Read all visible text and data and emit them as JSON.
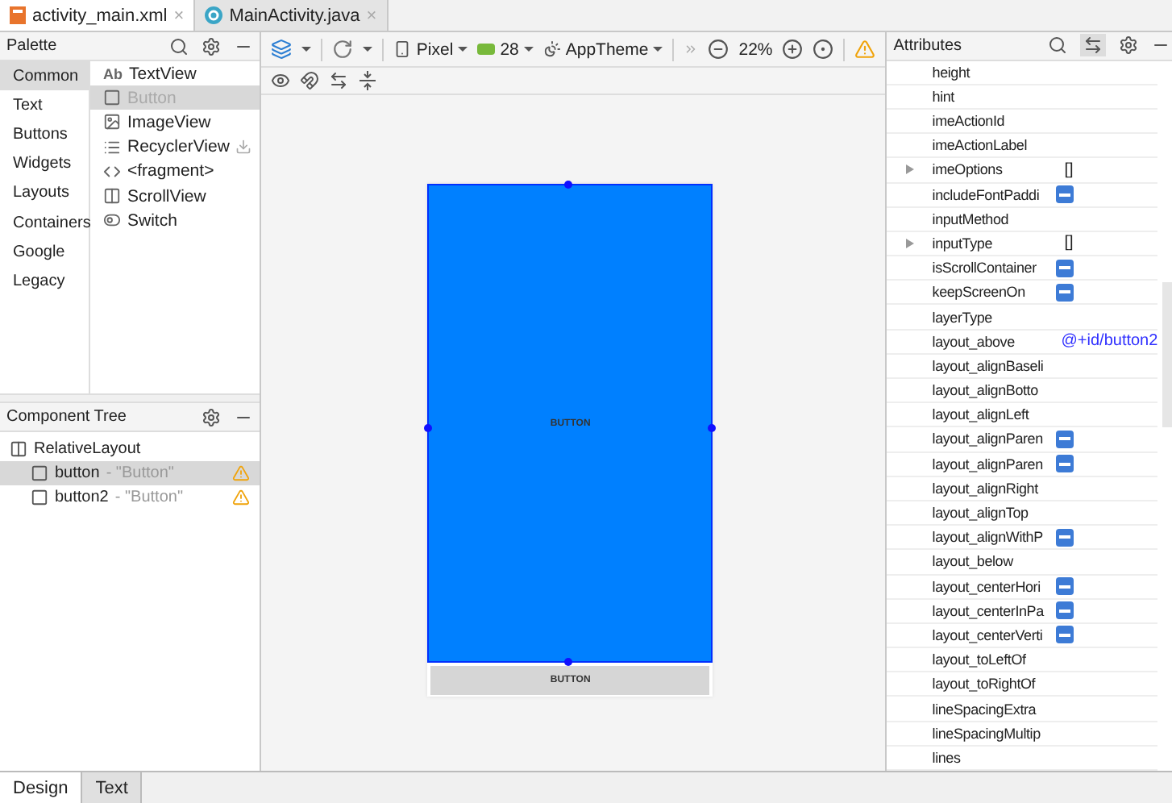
{
  "editor_tabs": [
    {
      "label": "activity_main.xml",
      "kind": "xml",
      "selected": true,
      "close": "×"
    },
    {
      "label": "MainActivity.java",
      "kind": "java",
      "selected": false,
      "close": "×"
    }
  ],
  "palette": {
    "title": "Palette",
    "categories": [
      {
        "label": "Common",
        "selected": true
      },
      {
        "label": "Text",
        "selected": false
      },
      {
        "label": "Buttons",
        "selected": false
      },
      {
        "label": "Widgets",
        "selected": false
      },
      {
        "label": "Layouts",
        "selected": false
      },
      {
        "label": "Containers",
        "selected": false
      },
      {
        "label": "Google",
        "selected": false
      },
      {
        "label": "Legacy",
        "selected": false
      }
    ],
    "items": [
      {
        "label": "TextView",
        "icon_text": "Ab",
        "kind": "text",
        "selected": false,
        "downloadable": false
      },
      {
        "label": "Button",
        "kind": "button",
        "selected": true,
        "downloadable": false
      },
      {
        "label": "ImageView",
        "kind": "image",
        "selected": false,
        "downloadable": false
      },
      {
        "label": "RecyclerView",
        "kind": "list",
        "selected": false,
        "downloadable": true
      },
      {
        "label": "<fragment>",
        "kind": "code",
        "selected": false,
        "downloadable": false
      },
      {
        "label": "ScrollView",
        "kind": "scroll",
        "selected": false,
        "downloadable": false
      },
      {
        "label": "Switch",
        "kind": "switch",
        "selected": false,
        "downloadable": false
      }
    ]
  },
  "component_tree": {
    "title": "Component Tree",
    "root": {
      "label": "RelativeLayout",
      "children": [
        {
          "id_label": "button",
          "text": "- \"Button\"",
          "selected": true,
          "warning": true
        },
        {
          "id_label": "button2",
          "text": "- \"Button\"",
          "selected": false,
          "warning": true
        }
      ]
    }
  },
  "toolbar": {
    "device": "Pixel",
    "api": "28",
    "theme": "AppTheme",
    "zoom": "22%"
  },
  "canvas": {
    "widgets": [
      {
        "label": "BUTTON",
        "selected": true
      },
      {
        "label": "BUTTON",
        "selected": false
      }
    ]
  },
  "attributes": {
    "title": "Attributes",
    "rows": [
      {
        "name": "height",
        "kind": "empty",
        "expandable": false
      },
      {
        "name": "hint",
        "kind": "empty",
        "expandable": false
      },
      {
        "name": "imeActionId",
        "kind": "empty",
        "expandable": false
      },
      {
        "name": "imeActionLabel",
        "kind": "empty",
        "expandable": false
      },
      {
        "name": "imeOptions",
        "kind": "text",
        "value": "[]",
        "expandable": true
      },
      {
        "name": "includeFontPaddi",
        "kind": "flag",
        "expandable": false
      },
      {
        "name": "inputMethod",
        "kind": "empty",
        "expandable": false
      },
      {
        "name": "inputType",
        "kind": "text",
        "value": "[]",
        "expandable": true
      },
      {
        "name": "isScrollContainer",
        "kind": "flag",
        "expandable": false
      },
      {
        "name": "keepScreenOn",
        "kind": "flag",
        "expandable": false
      },
      {
        "name": "layerType",
        "kind": "empty",
        "expandable": false
      },
      {
        "name": "layout_above",
        "kind": "link",
        "value": "@+id/button2",
        "expandable": false
      },
      {
        "name": "layout_alignBaseli",
        "kind": "empty",
        "expandable": false
      },
      {
        "name": "layout_alignBotto",
        "kind": "empty",
        "expandable": false
      },
      {
        "name": "layout_alignLeft",
        "kind": "empty",
        "expandable": false
      },
      {
        "name": "layout_alignParen",
        "kind": "flag",
        "expandable": false
      },
      {
        "name": "layout_alignParen",
        "kind": "flag",
        "expandable": false
      },
      {
        "name": "layout_alignRight",
        "kind": "empty",
        "expandable": false
      },
      {
        "name": "layout_alignTop",
        "kind": "empty",
        "expandable": false
      },
      {
        "name": "layout_alignWithP",
        "kind": "flag",
        "expandable": false
      },
      {
        "name": "layout_below",
        "kind": "empty",
        "expandable": false
      },
      {
        "name": "layout_centerHori",
        "kind": "flag",
        "expandable": false
      },
      {
        "name": "layout_centerInPa",
        "kind": "flag",
        "expandable": false
      },
      {
        "name": "layout_centerVerti",
        "kind": "flag",
        "expandable": false
      },
      {
        "name": "layout_toLeftOf",
        "kind": "empty",
        "expandable": false
      },
      {
        "name": "layout_toRightOf",
        "kind": "empty",
        "expandable": false
      },
      {
        "name": "lineSpacingExtra",
        "kind": "empty",
        "expandable": false
      },
      {
        "name": "lineSpacingMultip",
        "kind": "empty",
        "expandable": false
      },
      {
        "name": "lines",
        "kind": "empty",
        "expandable": false
      }
    ]
  },
  "bottom_tabs": [
    {
      "label": "Design",
      "selected": true
    },
    {
      "label": "Text",
      "selected": false
    }
  ]
}
